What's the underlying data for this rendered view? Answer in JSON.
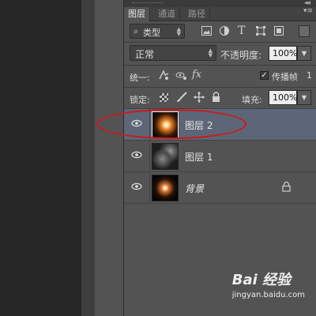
{
  "panel": {
    "tabs": [
      {
        "label": "图层",
        "active": true
      },
      {
        "label": "通道",
        "active": false
      },
      {
        "label": "路径",
        "active": false
      }
    ],
    "filter": {
      "kind_label": "类型",
      "filter_icons": [
        "image-filter-icon",
        "adjustment-filter-icon",
        "type-filter-icon",
        "shape-filter-icon",
        "smart-object-filter-icon"
      ]
    },
    "blend": {
      "mode": "正常",
      "opacity_label": "不透明度:",
      "opacity_value": "100%"
    },
    "unify": {
      "label": "统一:",
      "propagate_label": "传播帧",
      "propagate_value": "1",
      "propagate_checked": true
    },
    "lock": {
      "label": "锁定:",
      "fill_label": "填充:",
      "fill_value": "100%"
    },
    "layers": [
      {
        "name": "图层 2",
        "selected": true,
        "visible": true,
        "italic": false,
        "locked": false
      },
      {
        "name": "图层 1",
        "selected": false,
        "visible": true,
        "italic": false,
        "locked": false
      },
      {
        "name": "背景",
        "selected": false,
        "visible": true,
        "italic": true,
        "locked": true
      }
    ]
  },
  "watermark": {
    "brand": "Bai 经验",
    "url": "jingyan.baidu.com"
  },
  "colors": {
    "panel_bg": "#535353",
    "selected_row": "#5d6677",
    "annotation": "#d41414"
  }
}
